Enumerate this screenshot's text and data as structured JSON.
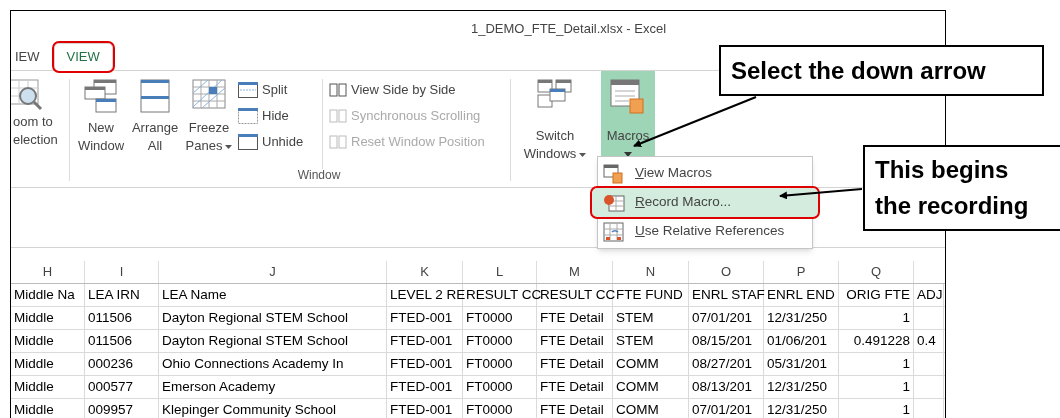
{
  "window": {
    "title": "1_DEMO_FTE_Detail.xlsx - Excel"
  },
  "tabs": [
    {
      "label": "IEW",
      "selected": false,
      "outlined": false
    },
    {
      "label": "VIEW",
      "selected": true,
      "outlined": true
    }
  ],
  "ribbon": {
    "zoom_button": {
      "lines": [
        "oom to",
        "election"
      ]
    },
    "window_group": {
      "label": "Window",
      "large_buttons": [
        {
          "kind": "new-window",
          "lines": [
            "New",
            "Window"
          ],
          "dropdown": false
        },
        {
          "kind": "arrange",
          "lines": [
            "Arrange",
            "All"
          ],
          "dropdown": false
        },
        {
          "kind": "freeze",
          "lines": [
            "Freeze",
            "Panes"
          ],
          "dropdown": true
        }
      ],
      "small_buttons": [
        {
          "kind": "split",
          "label": "Split"
        },
        {
          "kind": "hide",
          "label": "Hide"
        },
        {
          "kind": "unhide",
          "label": "Unhide"
        }
      ],
      "view_buttons": [
        {
          "label": "View Side by Side",
          "disabled": false
        },
        {
          "label": "Synchronous Scrolling",
          "disabled": true
        },
        {
          "label": "Reset Window Position",
          "disabled": true
        }
      ],
      "switch_button": {
        "lines": [
          "Switch",
          "Windows"
        ],
        "dropdown": true
      }
    },
    "macros_button": {
      "label": "Macros",
      "pressed": true
    }
  },
  "macros_menu": {
    "items": [
      {
        "kind": "view",
        "label": "View Macros",
        "selected": false,
        "outlined": false
      },
      {
        "kind": "record",
        "label": "Record Macro...",
        "selected": true,
        "outlined": true
      },
      {
        "kind": "relative",
        "label": "Use Relative References",
        "selected": false,
        "outlined": false
      }
    ]
  },
  "sheet": {
    "columns": [
      "H",
      "I",
      "J",
      "K",
      "L",
      "M",
      "N",
      "O",
      "P",
      "Q"
    ],
    "rows": [
      [
        "Middle Na",
        "LEA IRN",
        "LEA Name",
        "LEVEL 2 RE",
        "RESULT CC",
        "RESULT CC",
        "FTE FUND",
        "ENRL STAF",
        "ENRL END",
        "ORIG FTE",
        "ADJ"
      ],
      [
        "Middle",
        "011506",
        "Dayton Regional STEM School",
        "FTED-001",
        "FT0000",
        "FTE Detail",
        "STEM",
        "07/01/201",
        "12/31/250",
        "1",
        null
      ],
      [
        "Middle",
        "011506",
        "Dayton Regional STEM School",
        "FTED-001",
        "FT0000",
        "FTE Detail",
        "STEM",
        "08/15/201",
        "01/06/201",
        "0.491228",
        "0.4"
      ],
      [
        "Middle",
        "000236",
        "Ohio Connections Academy  In",
        "FTED-001",
        "FT0000",
        "FTE Detail",
        "COMM",
        "08/27/201",
        "05/31/201",
        "1",
        null
      ],
      [
        "Middle",
        "000577",
        "Emerson Academy",
        "FTED-001",
        "FT0000",
        "FTE Detail",
        "COMM",
        "08/13/201",
        "12/31/250",
        "1",
        null
      ],
      [
        "Middle",
        "009957",
        "Klepinger Community School",
        "FTED-001",
        "FT0000",
        "FTE Detail",
        "COMM",
        "07/01/201",
        "12/31/250",
        "1",
        null
      ]
    ]
  },
  "callouts": [
    {
      "text": "Select the down arrow"
    },
    {
      "text": "This begins the recording"
    }
  ]
}
